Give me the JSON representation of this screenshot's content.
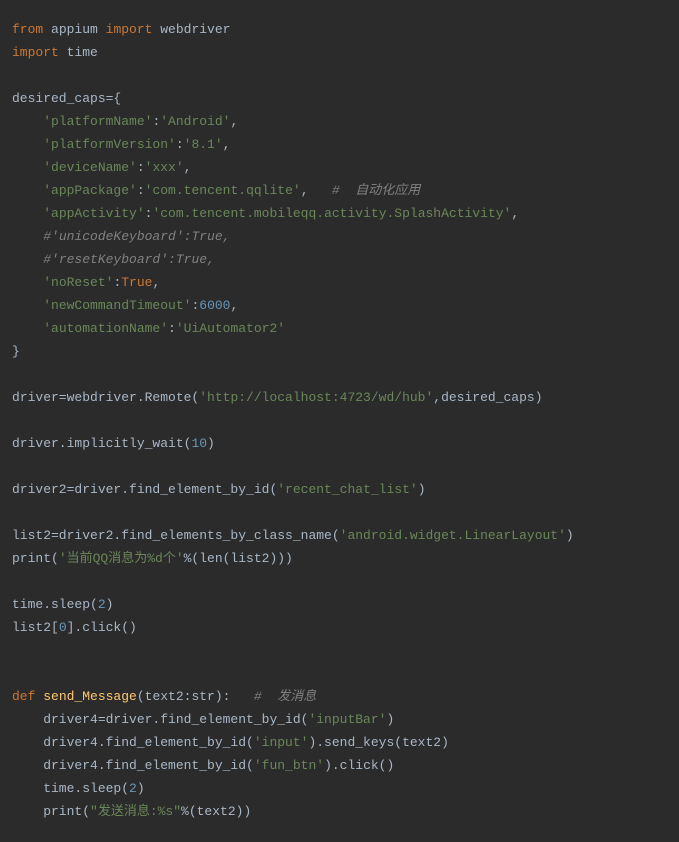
{
  "lines": {
    "l1_from": "from",
    "l1_appium": " appium ",
    "l1_import": "import",
    "l1_webdriver": " webdriver",
    "l2_import": "import",
    "l2_time": " time",
    "l3_text": "desired_caps={",
    "l4_indent": "    ",
    "l4_key": "'platformName'",
    "l4_colon": ":",
    "l4_val": "'Android'",
    "l4_comma": ",",
    "l5_key": "'platformVersion'",
    "l5_val": "'8.1'",
    "l6_key": "'deviceName'",
    "l6_val": "'xxx'",
    "l7_key": "'appPackage'",
    "l7_val": "'com.tencent.qqlite'",
    "l7_comment": "#  自动化应用",
    "l8_key": "'appActivity'",
    "l8_val": "'com.tencent.mobileqq.activity.SplashActivity'",
    "l9_comment": "#'unicodeKeyboard':True,",
    "l10_comment": "#'resetKeyboard':True,",
    "l11_key": "'noReset'",
    "l11_val": "True",
    "l12_key": "'newCommandTimeout'",
    "l12_val": "6000",
    "l13_key": "'automationName'",
    "l13_val": "'UiAutomator2'",
    "l14_close": "}",
    "l15_pre": "driver=webdriver.Remote(",
    "l15_url": "'http://localhost:4723/wd/hub'",
    "l15_post": ",desired_caps)",
    "l16_pre": "driver.implicitly_wait(",
    "l16_num": "10",
    "l16_post": ")",
    "l17_pre": "driver2=driver.find_element_by_id(",
    "l17_str": "'recent_chat_list'",
    "l17_post": ")",
    "l18_pre": "list2=driver2.find_elements_by_class_name(",
    "l18_str": "'android.widget.LinearLayout'",
    "l18_post": ")",
    "l19_pre": "print(",
    "l19_str": "'当前QQ消息为%d个'",
    "l19_post": "%(len(list2)))",
    "l20_pre": "time.sleep(",
    "l20_num": "2",
    "l20_post": ")",
    "l21_pre": "list2[",
    "l21_num": "0",
    "l21_post": "].click()",
    "l22_def": "def",
    "l22_space": " ",
    "l22_fname": "send_Message",
    "l22_sig": "(text2:str):   ",
    "l22_comment": "#  发消息",
    "l23_pre": "    driver4=driver.find_element_by_id(",
    "l23_str": "'inputBar'",
    "l23_post": ")",
    "l24_pre": "    driver4.find_element_by_id(",
    "l24_str": "'input'",
    "l24_post": ").send_keys(text2)",
    "l25_pre": "    driver4.find_element_by_id(",
    "l25_str": "'fun_btn'",
    "l25_post": ").click()",
    "l26_pre": "    time.sleep(",
    "l26_num": "2",
    "l26_post": ")",
    "l27_pre": "    print(",
    "l27_str": "\"发送消息:%s\"",
    "l27_post": "%(text2))"
  }
}
